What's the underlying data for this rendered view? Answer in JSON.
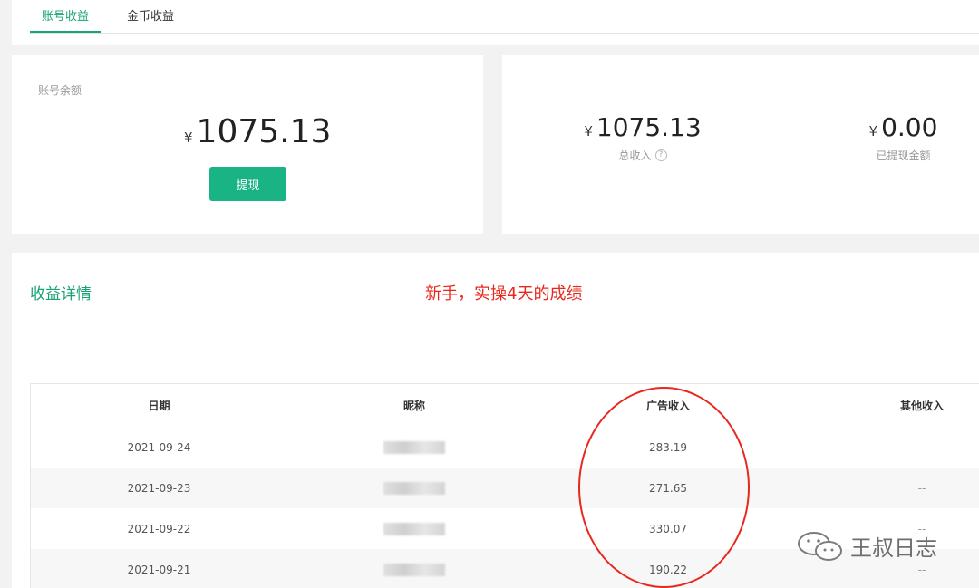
{
  "tabs": [
    {
      "label": "账号收益",
      "active": true
    },
    {
      "label": "金币收益",
      "active": false
    }
  ],
  "balance": {
    "label": "账号余额",
    "currency": "¥",
    "amount": "1075.13",
    "withdraw_button": "提现"
  },
  "summary": {
    "total": {
      "currency": "¥",
      "amount": "1075.13",
      "label": "总收入"
    },
    "withdrawn": {
      "currency": "¥",
      "amount": "0.00",
      "label": "已提现金额"
    }
  },
  "detail": {
    "title": "收益详情",
    "annotation": "新手，实操4天的成绩",
    "columns": [
      "日期",
      "昵称",
      "广告收入",
      "其他收入"
    ],
    "rows": [
      {
        "date": "2021-09-24",
        "ad_income": "283.19",
        "other_income": "--"
      },
      {
        "date": "2021-09-23",
        "ad_income": "271.65",
        "other_income": "--"
      },
      {
        "date": "2021-09-22",
        "ad_income": "330.07",
        "other_income": "--"
      },
      {
        "date": "2021-09-21",
        "ad_income": "190.22",
        "other_income": "--"
      }
    ]
  },
  "watermark": {
    "text": "王叔日志",
    "icon": "wechat-icon"
  },
  "colors": {
    "accent": "#19a373",
    "button": "#19b384",
    "annotation": "#e8281e"
  }
}
